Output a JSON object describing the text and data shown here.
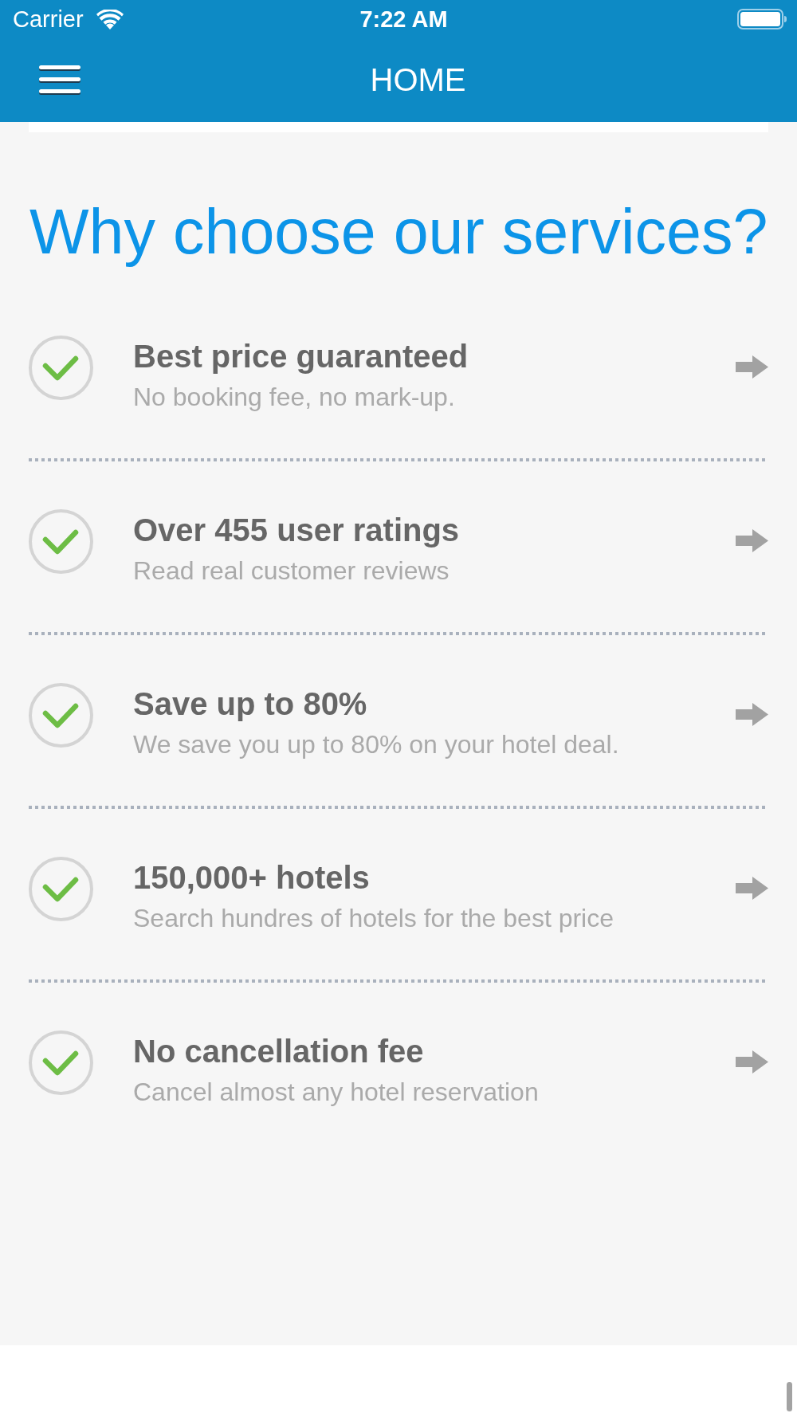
{
  "status_bar": {
    "carrier": "Carrier",
    "time": "7:22 AM"
  },
  "header": {
    "title": "HOME"
  },
  "heading": "Why choose our services?",
  "features": [
    {
      "title": "Best price guaranteed",
      "subtitle": "No booking fee, no mark-up."
    },
    {
      "title": "Over 455 user ratings",
      "subtitle": "Read real customer reviews"
    },
    {
      "title": "Save up to 80%",
      "subtitle": "We save you up to 80% on your hotel deal."
    },
    {
      "title": "150,000+ hotels",
      "subtitle": "Search hundres of hotels for the best price"
    },
    {
      "title": "No cancellation fee",
      "subtitle": "Cancel almost any hotel reservation"
    }
  ]
}
